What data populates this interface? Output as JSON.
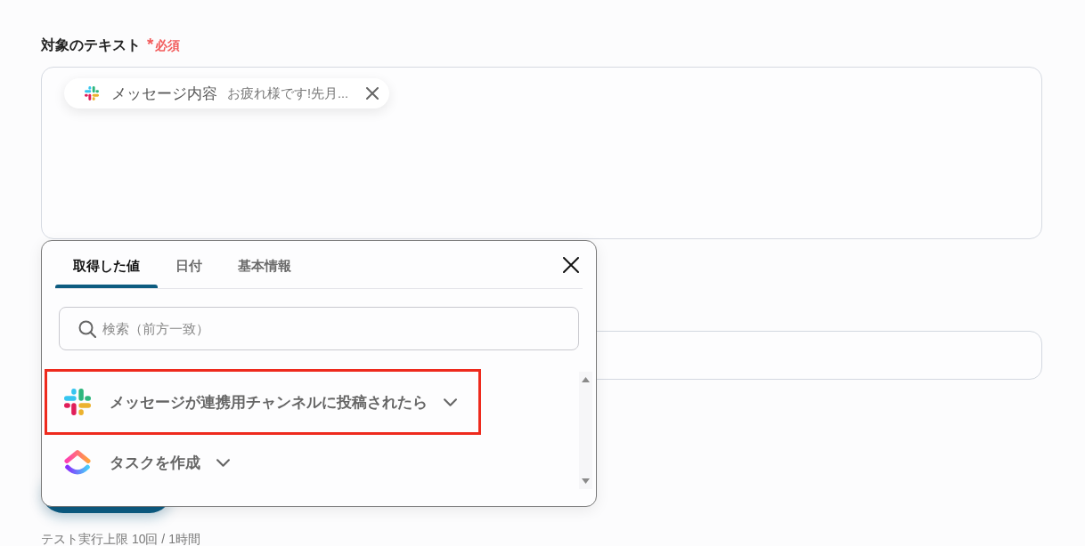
{
  "field": {
    "label": "対象のテキスト",
    "required_mark": "*",
    "required_text": "必須",
    "chip": {
      "kind": "hash",
      "name": "メッセージ内容",
      "value": "お疲れ様です!先月..."
    }
  },
  "dropdown": {
    "tabs": [
      {
        "label": "取得した値",
        "selected": true
      },
      {
        "label": "日付",
        "selected": false
      },
      {
        "label": "基本情報",
        "selected": false
      }
    ],
    "search": {
      "placeholder": "検索（前方一致）"
    },
    "items": [
      {
        "kind": "hash",
        "label": "メッセージが連携用チャンネルに投稿されたら",
        "highlighted": true
      },
      {
        "kind": "arc",
        "label": "タスクを作成",
        "highlighted": false
      }
    ]
  },
  "footer_note": "テスト実行上限 10回 / 1時間"
}
